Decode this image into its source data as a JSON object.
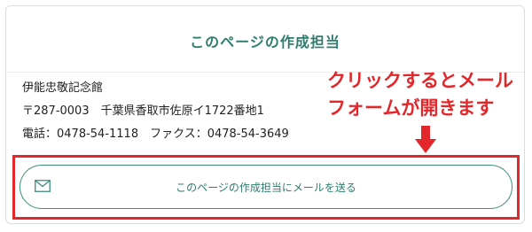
{
  "card": {
    "title": "このページの作成担当"
  },
  "contact": {
    "name": "伊能忠敬記念館",
    "address": "〒287-0003　千葉県香取市佐原イ1722番地1",
    "phone_fax": "電話：0478-54-1118　ファクス：0478-54-3649"
  },
  "annotation": {
    "line1": "クリックするとメール",
    "line2": "フォームが開きます"
  },
  "mail_button": {
    "label": "このページの作成担当にメールを送る",
    "icon": "mail-icon"
  },
  "colors": {
    "accent": "#2e7d6e",
    "annotation_red": "#e2262a",
    "border": "#dcdcdc"
  }
}
